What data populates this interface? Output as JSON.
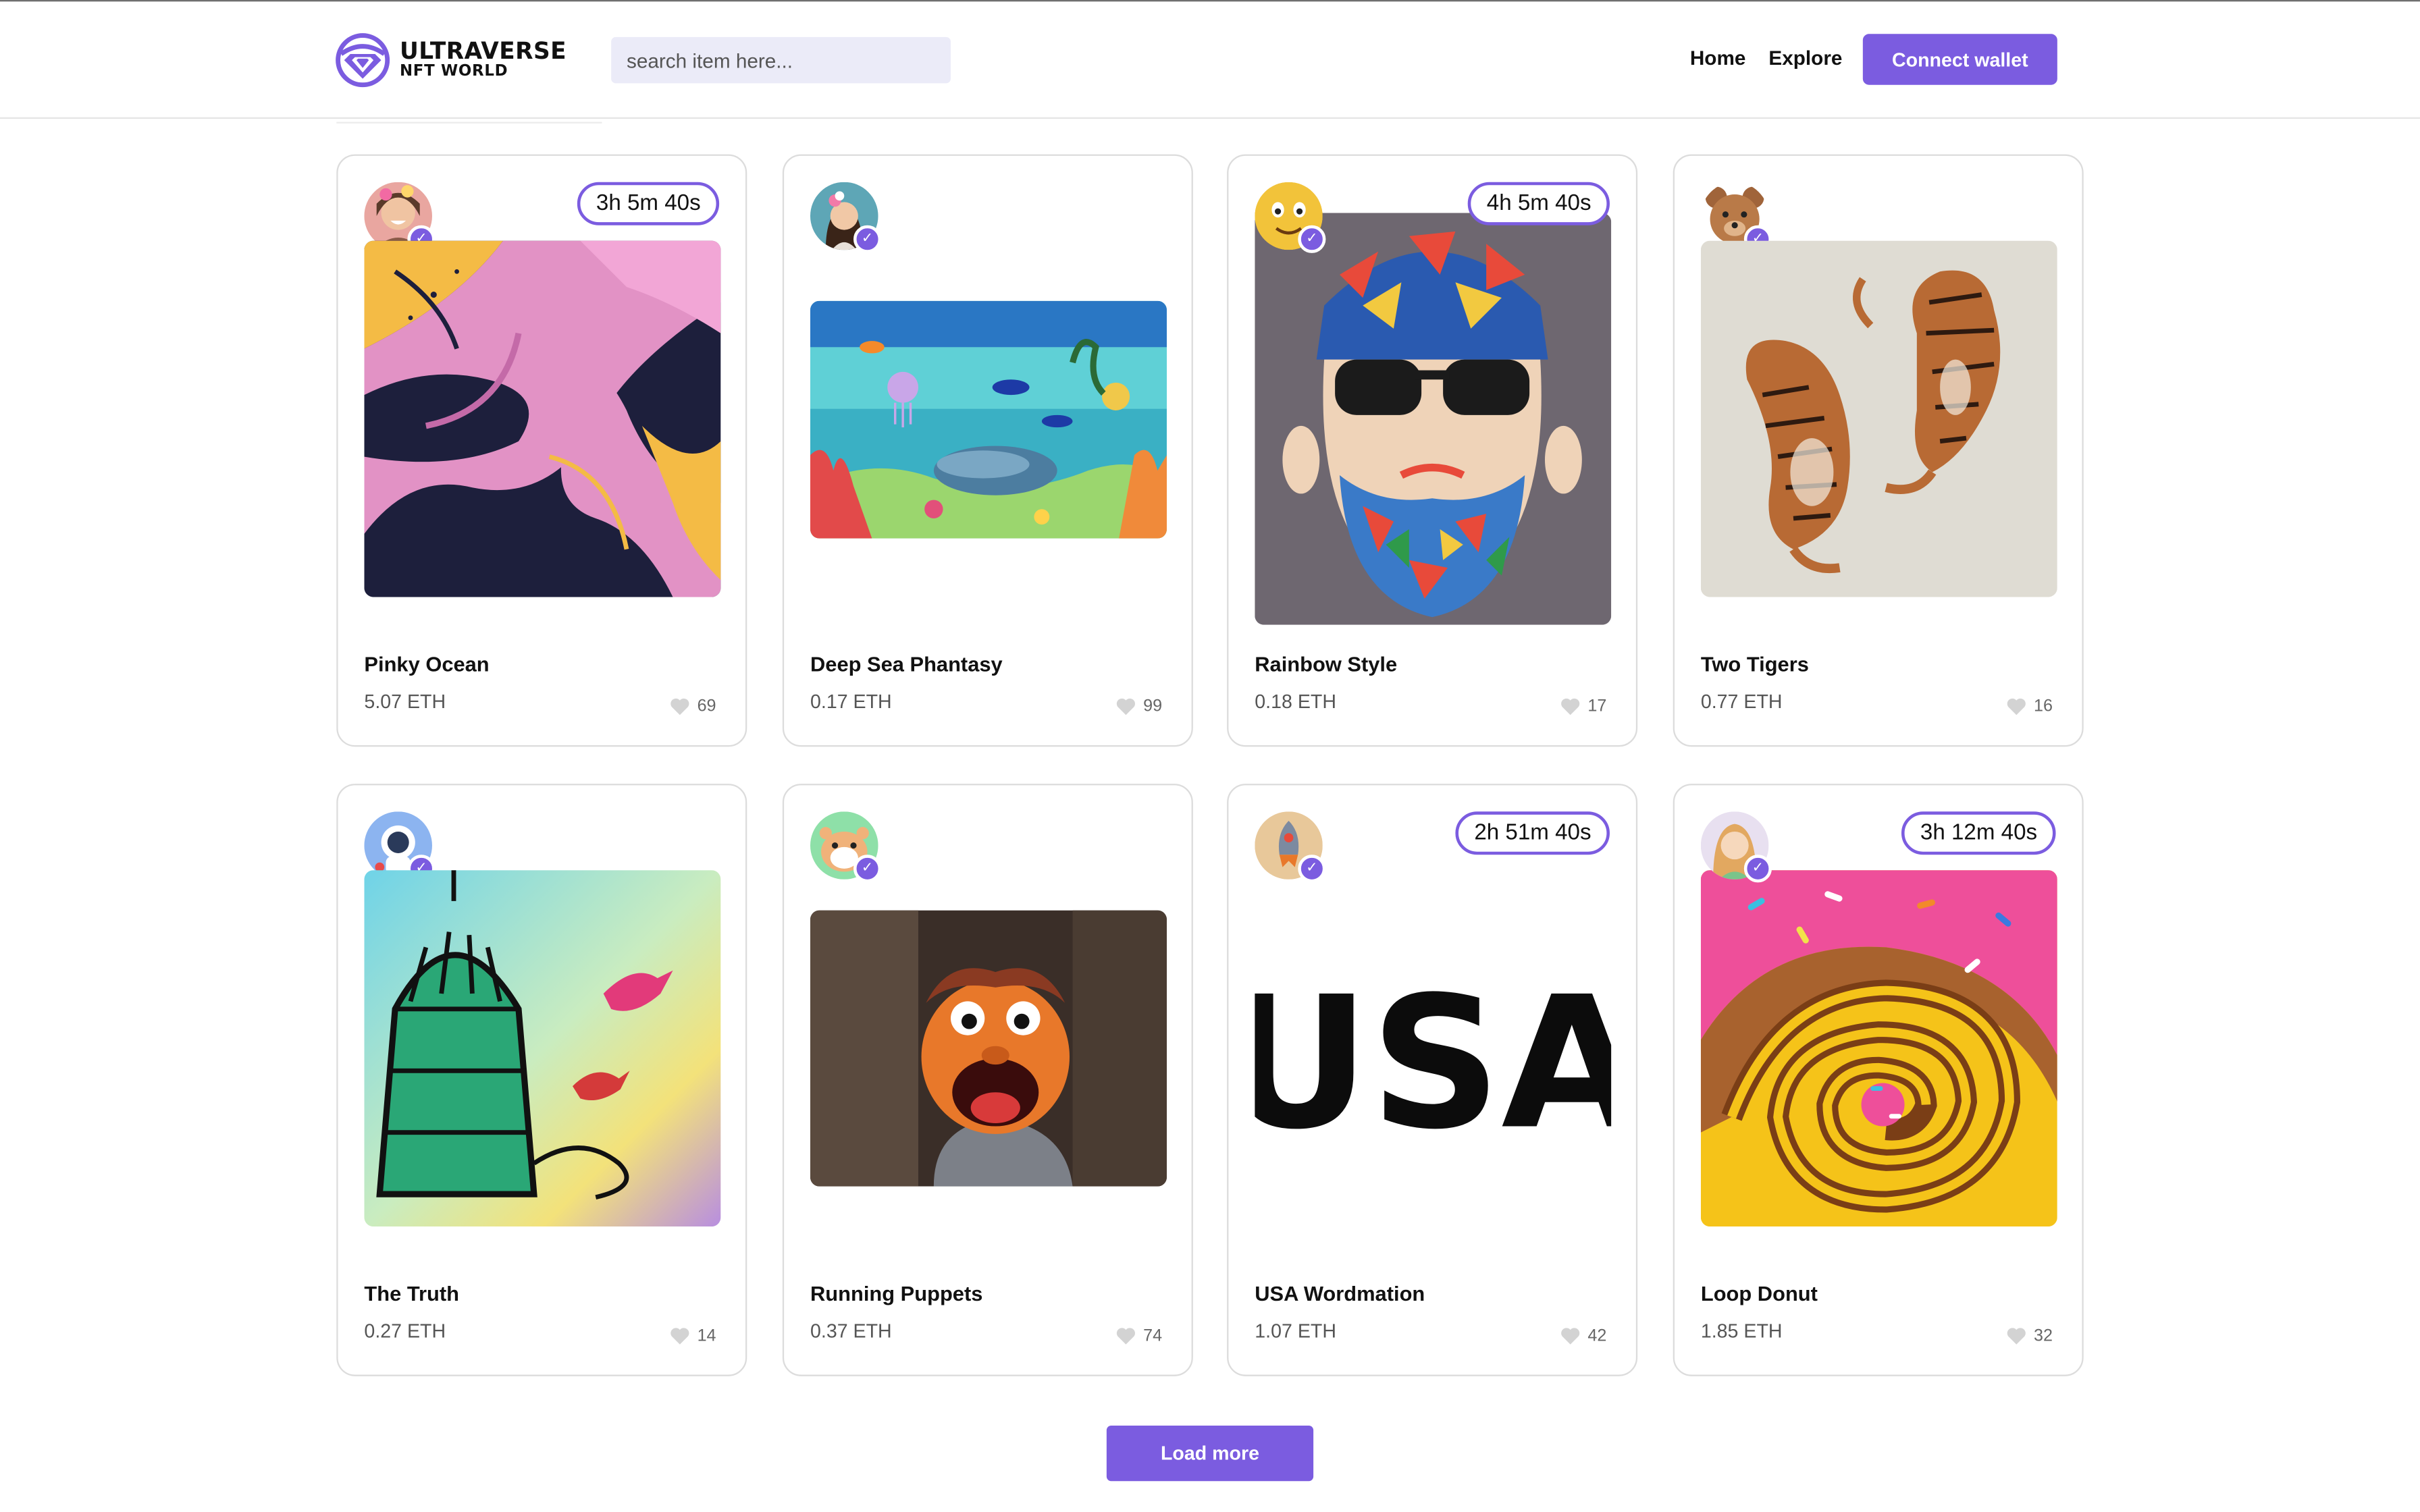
{
  "header": {
    "logo_title": "ULTRAVERSE",
    "logo_subtitle": "NFT WORLD",
    "search_placeholder": "search item here...",
    "nav": [
      "Home",
      "Explore"
    ],
    "connect_label": "Connect wallet"
  },
  "accent_color": "#7b5ce0",
  "cards": [
    {
      "title": "Pinky Ocean",
      "price": "5.07 ETH",
      "likes": "69",
      "timer": "3h 5m 40s",
      "avatar_icon": "woman-flower-avatar",
      "art_icon": "pink-marble-art"
    },
    {
      "title": "Deep Sea Phantasy",
      "price": "0.17 ETH",
      "likes": "99",
      "timer": "",
      "avatar_icon": "woman-hair-flower-avatar",
      "art_icon": "underwater-scene-art"
    },
    {
      "title": "Rainbow Style",
      "price": "0.18 ETH",
      "likes": "17",
      "timer": "4h 5m 40s",
      "avatar_icon": "emoji-face-avatar",
      "art_icon": "bearded-man-art"
    },
    {
      "title": "Two Tigers",
      "price": "0.77 ETH",
      "likes": "16",
      "timer": "",
      "avatar_icon": "teddy-bear-avatar",
      "art_icon": "two-tigers-art"
    },
    {
      "title": "The Truth",
      "price": "0.27 ETH",
      "likes": "14",
      "timer": "",
      "avatar_icon": "astronaut-avatar",
      "art_icon": "birdcage-lettering-art"
    },
    {
      "title": "Running Puppets",
      "price": "0.37 ETH",
      "likes": "74",
      "timer": "",
      "avatar_icon": "hamster-avatar",
      "art_icon": "muppet-art"
    },
    {
      "title": "USA Wordmation",
      "price": "1.07 ETH",
      "likes": "42",
      "timer": "2h 51m 40s",
      "avatar_icon": "rocket-avatar",
      "art_icon": "usa-lettering-art",
      "art_text": "USA"
    },
    {
      "title": "Loop Donut",
      "price": "1.85 ETH",
      "likes": "32",
      "timer": "3h 12m 40s",
      "avatar_icon": "girl-avatar",
      "art_icon": "donut-spiral-art"
    }
  ],
  "load_more_label": "Load more",
  "check_glyph": "✓"
}
